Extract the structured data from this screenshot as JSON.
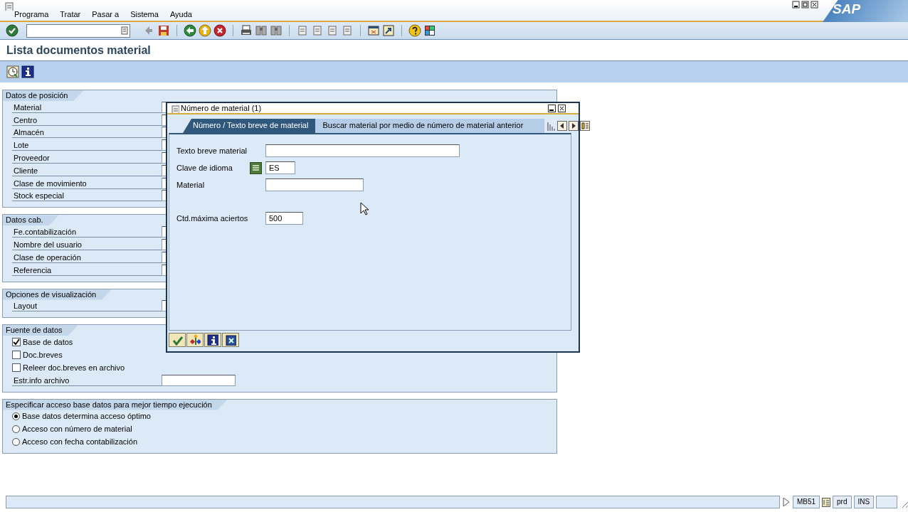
{
  "window": {
    "menu": [
      "Programa",
      "Tratar",
      "Pasar a",
      "Sistema",
      "Ayuda"
    ],
    "logo": "SAP"
  },
  "screen_title": "Lista documentos material",
  "groups": [
    {
      "title": "Datos de posición",
      "rows": [
        {
          "kind": "field",
          "label": "Material"
        },
        {
          "kind": "field",
          "label": "Centro"
        },
        {
          "kind": "field",
          "label": "Almacén"
        },
        {
          "kind": "field",
          "label": "Lote"
        },
        {
          "kind": "field",
          "label": "Proveedor"
        },
        {
          "kind": "field",
          "label": "Cliente"
        },
        {
          "kind": "field",
          "label": "Clase de movimiento"
        },
        {
          "kind": "field",
          "label": "Stock especial"
        }
      ]
    },
    {
      "title": "Datos cab.",
      "rows": [
        {
          "kind": "field",
          "label": "Fe.contabilización"
        },
        {
          "kind": "field",
          "label": "Nombre del usuario"
        },
        {
          "kind": "field",
          "label": "Clase de operación"
        },
        {
          "kind": "field",
          "label": "Referencia"
        }
      ]
    },
    {
      "title": "Opciones de visualización",
      "rows": [
        {
          "kind": "field",
          "label": "Layout"
        }
      ]
    },
    {
      "title": "Fuente de datos",
      "rows": [
        {
          "kind": "checkbox",
          "label": "Base de datos",
          "checked": true
        },
        {
          "kind": "checkbox",
          "label": "Doc.breves",
          "checked": false
        },
        {
          "kind": "checkbox",
          "label": "Releer doc.breves en archivo",
          "checked": false
        },
        {
          "kind": "field",
          "label": "Estr.info archivo"
        }
      ]
    },
    {
      "title": "Especificar acceso base datos para mejor tiempo ejecución",
      "rows": [
        {
          "kind": "radio",
          "label": "Base datos determina acceso óptimo",
          "selected": true
        },
        {
          "kind": "radio",
          "label": "Acceso con número de material",
          "selected": false
        },
        {
          "kind": "radio",
          "label": "Acceso con fecha contabilización",
          "selected": false
        }
      ]
    }
  ],
  "dialog": {
    "title": "Número de material (1)",
    "tabs": [
      {
        "label": "Número / Texto breve de material",
        "selected": true
      },
      {
        "label": "Buscar material por medio de número de material anterior",
        "selected": false
      }
    ],
    "fields": [
      {
        "kind": "wide",
        "label": "Texto breve material"
      },
      {
        "kind": "language",
        "label": "Clave de idioma",
        "value": "ES"
      },
      {
        "kind": "medium",
        "label": "Material"
      },
      {
        "kind": "short",
        "label": "Ctd.máxima aciertos",
        "value": "500"
      }
    ]
  },
  "status_bar": {
    "transaction": "MB51",
    "system": "prd",
    "mode": "INS"
  }
}
